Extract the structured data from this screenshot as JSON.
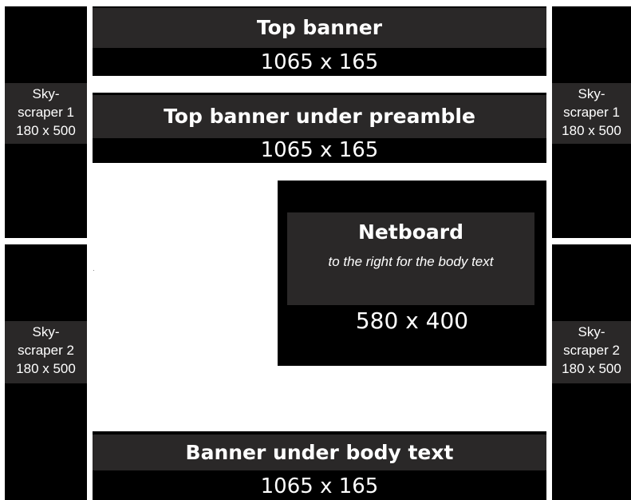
{
  "skyscrapers": {
    "left_1": {
      "line1": "Sky-",
      "line2": "scraper 1",
      "line3": "180 x 500"
    },
    "right_1": {
      "line1": "Sky-",
      "line2": "scraper 1",
      "line3": "180 x 500"
    },
    "left_2": {
      "line1": "Sky-",
      "line2": "scraper 2",
      "line3": "180 x 500"
    },
    "right_2": {
      "line1": "Sky-",
      "line2": "scraper 2",
      "line3": "180 x 500"
    }
  },
  "top_banner": {
    "title": "Top banner",
    "size": "1065 x 165"
  },
  "top_banner_preamble": {
    "title": "Top banner under preamble",
    "size": "1065 x 165"
  },
  "netboard": {
    "title": "Netboard",
    "subtitle": "to the right for the body text",
    "size": "580 x 400"
  },
  "bottom_banner": {
    "title": "Banner under body text",
    "size": "1065 x 165"
  },
  "colors": {
    "ad_background": "#000000",
    "label_background": "#2a2828",
    "text": "#ffffff",
    "page_background": "#ffffff"
  }
}
